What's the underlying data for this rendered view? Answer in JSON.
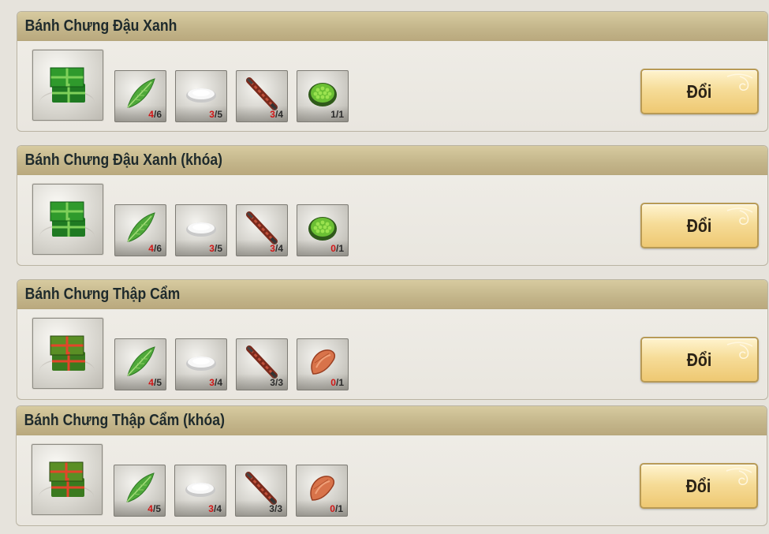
{
  "recipes": [
    {
      "title": "Bánh Chưng Đậu Xanh",
      "result_icon": "banh-chung-green-icon",
      "materials": [
        {
          "icon": "leaf-icon",
          "have": "4",
          "need": "6",
          "short": true
        },
        {
          "icon": "rice-plate-icon",
          "have": "3",
          "need": "5",
          "short": true
        },
        {
          "icon": "pork-skewer-icon",
          "have": "3",
          "need": "4",
          "short": true
        },
        {
          "icon": "mung-bean-bowl-icon",
          "have": "1",
          "need": "1",
          "short": false
        }
      ],
      "button": "Đổi"
    },
    {
      "title": "Bánh Chưng Đậu Xanh (khóa)",
      "result_icon": "banh-chung-green-icon",
      "materials": [
        {
          "icon": "leaf-icon",
          "have": "4",
          "need": "6",
          "short": true
        },
        {
          "icon": "rice-plate-icon",
          "have": "3",
          "need": "5",
          "short": true
        },
        {
          "icon": "pork-skewer-icon",
          "have": "3",
          "need": "4",
          "short": true
        },
        {
          "icon": "mung-bean-bowl-icon",
          "have": "0",
          "need": "1",
          "short": true
        }
      ],
      "button": "Đổi"
    },
    {
      "title": "Bánh Chưng Thập Cẩm",
      "result_icon": "banh-chung-mixed-icon",
      "materials": [
        {
          "icon": "leaf-icon",
          "have": "4",
          "need": "5",
          "short": true
        },
        {
          "icon": "rice-plate-icon",
          "have": "3",
          "need": "4",
          "short": true
        },
        {
          "icon": "pork-skewer-icon",
          "have": "3",
          "need": "3",
          "short": false
        },
        {
          "icon": "sausage-icon",
          "have": "0",
          "need": "1",
          "short": true
        }
      ],
      "button": "Đổi"
    },
    {
      "title": "Bánh Chưng Thập Cẩm (khóa)",
      "result_icon": "banh-chung-mixed-icon",
      "materials": [
        {
          "icon": "leaf-icon",
          "have": "4",
          "need": "5",
          "short": true
        },
        {
          "icon": "rice-plate-icon",
          "have": "3",
          "need": "4",
          "short": true
        },
        {
          "icon": "pork-skewer-icon",
          "have": "3",
          "need": "3",
          "short": false
        },
        {
          "icon": "sausage-icon",
          "have": "0",
          "need": "1",
          "short": true
        }
      ],
      "button": "Đổi"
    }
  ],
  "colors": {
    "header": "#c8ba8f",
    "shortage": "#d11616",
    "button": "#f6dc98"
  }
}
